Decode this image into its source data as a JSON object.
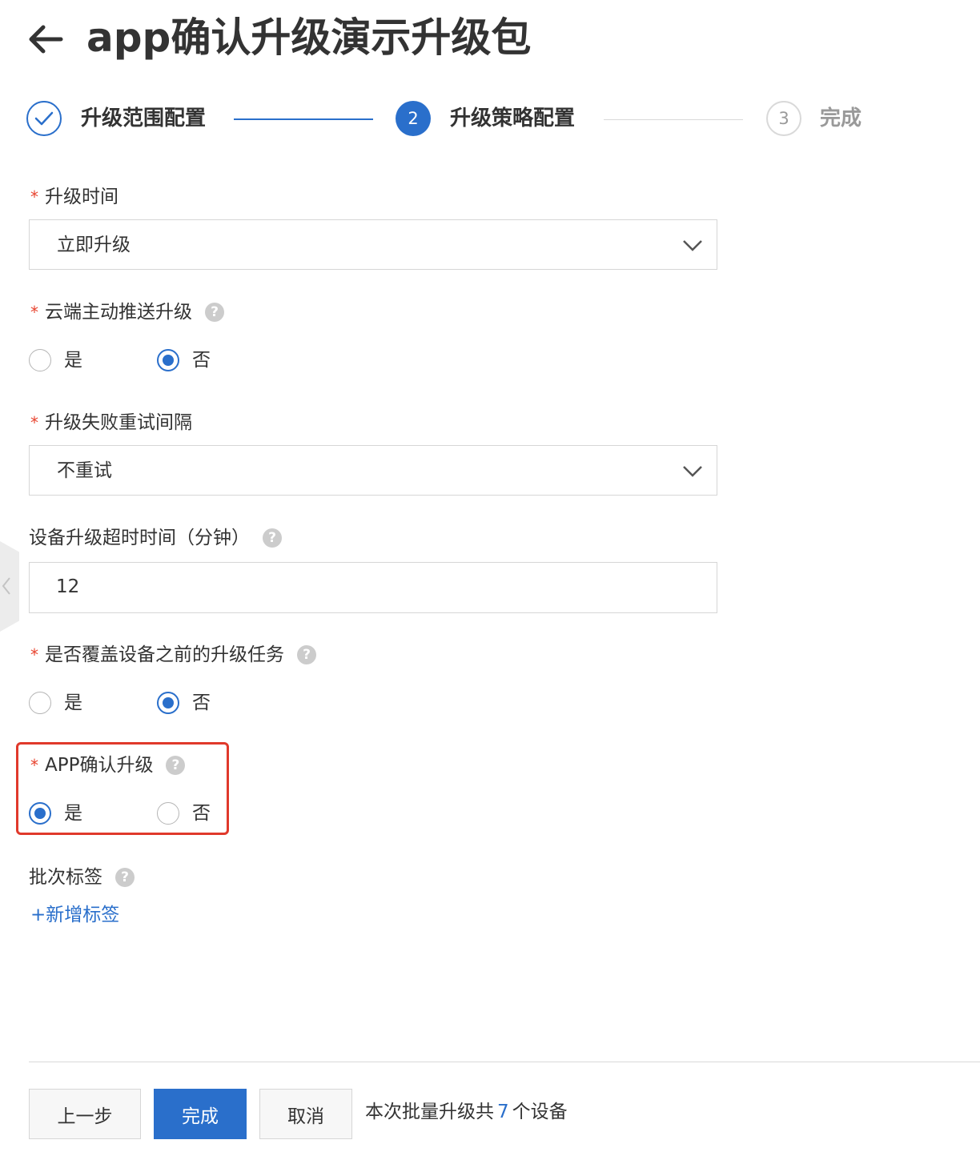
{
  "header": {
    "title": "app确认升级演示升级包",
    "back_icon": "arrow-left-icon"
  },
  "steps": [
    {
      "label": "升级范围配置",
      "state": "done",
      "icon": "check-icon"
    },
    {
      "label": "升级策略配置",
      "state": "active",
      "number": "2"
    },
    {
      "label": "完成",
      "state": "pending",
      "number": "3"
    }
  ],
  "form": {
    "upgrade_time": {
      "label": "升级时间",
      "required_mark": "*",
      "value": "立即升级"
    },
    "cloud_push": {
      "label": "云端主动推送升级",
      "required_mark": "*",
      "help": "?",
      "options": [
        "是",
        "否"
      ],
      "selected": "否"
    },
    "retry_interval": {
      "label": "升级失败重试间隔",
      "required_mark": "*",
      "value": "不重试"
    },
    "timeout": {
      "label": "设备升级超时时间（分钟）",
      "help": "?",
      "value": "12"
    },
    "overwrite": {
      "label": "是否覆盖设备之前的升级任务",
      "required_mark": "*",
      "help": "?",
      "options": [
        "是",
        "否"
      ],
      "selected": "否"
    },
    "app_confirm": {
      "label": "APP确认升级",
      "required_mark": "*",
      "help": "?",
      "options": [
        "是",
        "否"
      ],
      "selected": "是"
    },
    "batch_tag": {
      "label": "批次标签",
      "help": "?",
      "add_label": "+新增标签"
    }
  },
  "footer": {
    "prev_label": "上一步",
    "done_label": "完成",
    "cancel_label": "取消",
    "summary_prefix": "本次批量升级共",
    "device_count": "7",
    "summary_suffix": "个设备"
  },
  "colors": {
    "accent": "#2a6fcb",
    "required": "#e8442f",
    "highlight_border": "#e0392b"
  }
}
